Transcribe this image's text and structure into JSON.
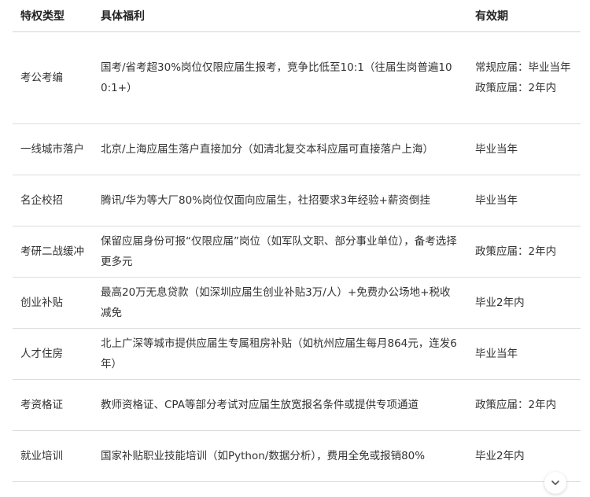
{
  "table": {
    "headers": [
      "特权类型",
      "具体福利",
      "有效期"
    ],
    "rows": [
      {
        "type": "考公考编",
        "benefit": "国考/省考超30%岗位仅限应届生报考，竞争比低至10:1（往届生岗普遍100:1+）",
        "validity": "常规应届：毕业当年\n政策应届：2年内"
      },
      {
        "type": "一线城市落户",
        "benefit": "北京/上海应届生落户直接加分（如清北复交本科应届可直接落户上海）",
        "validity": "毕业当年"
      },
      {
        "type": "名企校招",
        "benefit": "腾讯/华为等大厂80%岗位仅面向应届生，社招要求3年经验+薪资倒挂",
        "validity": "毕业当年"
      },
      {
        "type": "考研二战缓冲",
        "benefit": "保留应届身份可报“仅限应届”岗位（如军队文职、部分事业单位），备考选择更多元",
        "validity": "政策应届：2年内"
      },
      {
        "type": "创业补贴",
        "benefit": "最高20万无息贷款（如深圳应届生创业补贴3万/人）+免费办公场地+税收减免",
        "validity": "毕业2年内"
      },
      {
        "type": "人才住房",
        "benefit": "北上广深等城市提供应届生专属租房补贴（如杭州应届生每月864元，连发6年）",
        "validity": "毕业当年"
      },
      {
        "type": "考资格证",
        "benefit": "教师资格证、CPA等部分考试对应届生放宽报名条件或提供专项通道",
        "validity": "政策应届：2年内"
      },
      {
        "type": "就业培训",
        "benefit": "国家补贴职业技能培训（如Python/数据分析），费用全免或报销80%",
        "validity": "毕业2年内"
      }
    ]
  },
  "scroll_button": {
    "icon": "chevron-down-icon"
  }
}
